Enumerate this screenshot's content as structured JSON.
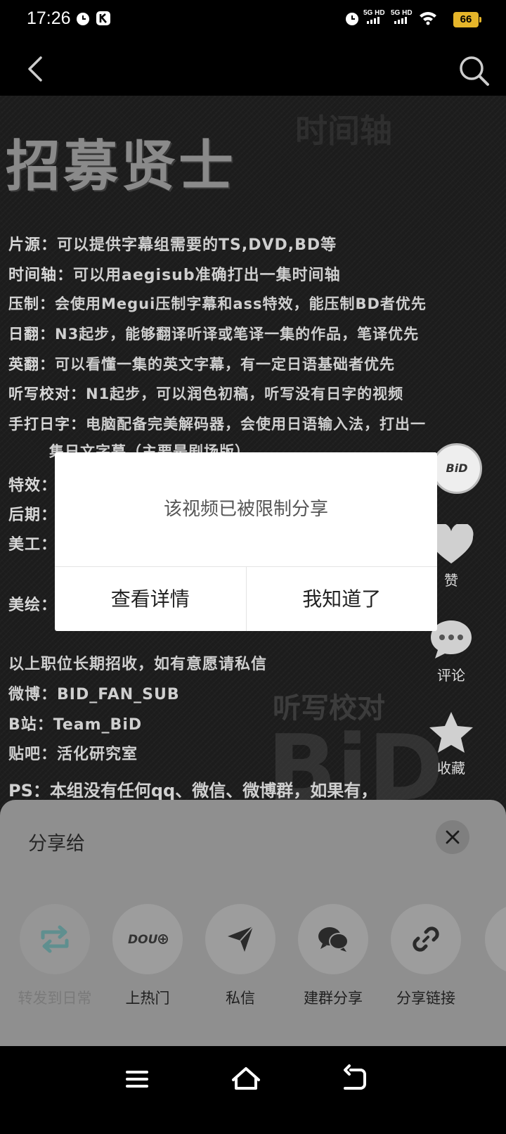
{
  "status_bar": {
    "time": "17:26",
    "net1": "5G HD",
    "net2": "5G HD",
    "battery": "66",
    "battery_color": "#e5b52a"
  },
  "nav": {
    "back_icon": "chevron-left-icon",
    "search_icon": "search-icon"
  },
  "poster": {
    "title": "招募贤士",
    "requirements": [
      {
        "label": "片源：",
        "text": "可以提供字幕组需要的TS,DVD,BD等"
      },
      {
        "label": "时间轴：",
        "text": "可以用aegisub准确打出一集时间轴"
      },
      {
        "label": "压制：",
        "text": "会使用Megui压制字幕和ass特效，能压制BD者优先"
      },
      {
        "label": "日翻：",
        "text": "N3起步，能够翻译听译或笔译一集的作品，笔译优先"
      },
      {
        "label": "英翻：",
        "text": "可以看懂一集的英文字幕，有一定日语基础者优先"
      },
      {
        "label": "听写校对：",
        "text": "N1起步，可以润色初稿，听写没有日字的视频"
      },
      {
        "label": "手打日字：",
        "text": "电脑配备完美解码器，会使用日语输入法，打出一"
      },
      {
        "label": "",
        "text": "集日文字幕（主要是剧场版）"
      },
      {
        "label": "特效：",
        "text": ""
      },
      {
        "label": "后期：",
        "text": ""
      },
      {
        "label": "美工：",
        "text": ""
      },
      {
        "label": "美绘：",
        "text": ""
      }
    ],
    "contacts": [
      "以上职位长期招收，如有意愿请私信",
      "微博：BID_FAN_SUB",
      "B站：Team_BiD",
      "贴吧：活化研究室"
    ],
    "ps": "PS：本组没有任何qq、微信、微博群，如果有，",
    "bg_words": [
      "时间轴",
      "听写校对",
      "BiD"
    ]
  },
  "side": {
    "avatar_text": "BiD",
    "like_label": "赞",
    "comment_label": "评论",
    "favorite_label": "收藏"
  },
  "dialog": {
    "message": "该视频已被限制分享",
    "details_button": "查看详情",
    "ok_button": "我知道了"
  },
  "share": {
    "title": "分享给",
    "items": [
      {
        "label": "转发到日常",
        "icon": "repost-icon"
      },
      {
        "label": "上热门",
        "icon": "dou-plus-icon"
      },
      {
        "label": "私信",
        "icon": "send-icon"
      },
      {
        "label": "建群分享",
        "icon": "group-chat-icon"
      },
      {
        "label": "分享链接",
        "icon": "link-icon"
      }
    ]
  },
  "system_nav": {
    "menu_icon": "menu-icon",
    "home_icon": "home-icon",
    "back_icon": "back-icon"
  }
}
